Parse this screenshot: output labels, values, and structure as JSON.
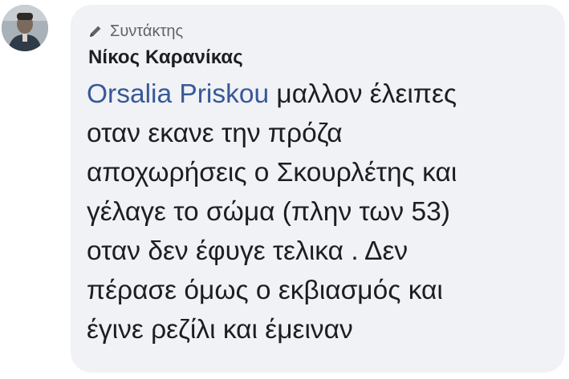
{
  "comment": {
    "avatar_icon": "profile-photo",
    "role_icon": "pencil-icon",
    "role_label": "Συντάκτης",
    "author_name": "Νίκος Καρανίκας",
    "mention": "Orsalia Priskou",
    "lines": [
      " μαλλον έλειπες",
      "οταν εκανε την πρόζα",
      "αποχωρήσεις ο Σκουρλέτης και",
      "γέλαγε το σώμα (πλην των 53)",
      "οταν δεν έφυγε τελικα . Δεν",
      "πέρασε όμως ο εκβιασμός και",
      "έγινε ρεζίλι και έμειναν"
    ],
    "colors": {
      "bubble_background": "#f0f2f5",
      "mention": "#385898",
      "text": "#1c1e21",
      "secondary_text": "#5f6368"
    }
  }
}
